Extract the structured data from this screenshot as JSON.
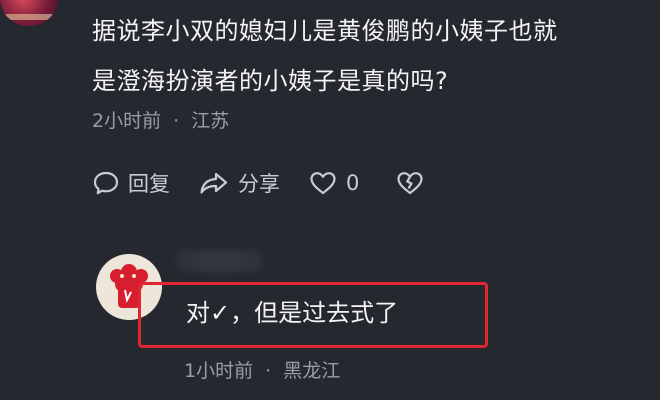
{
  "comment": {
    "text_line1": "据说李小双的媳妇儿是黄俊鹏的小姨子也就",
    "text_line2": "是澄海扮演者的小姨子是真的吗?",
    "time": "2小时前",
    "separator": "·",
    "location": "江苏",
    "actions": {
      "reply_label": "回复",
      "share_label": "分享",
      "like_count": "0"
    }
  },
  "reply": {
    "text": "对✓，但是过去式了",
    "time": "1小时前",
    "separator": "·",
    "location": "黑龙江"
  },
  "colors": {
    "background": "#25282f",
    "highlight_border": "#e1262f",
    "meta_text": "#9a9da6"
  },
  "icons": [
    "comment-bubble-icon",
    "share-arrow-icon",
    "heart-icon",
    "broken-heart-icon"
  ]
}
